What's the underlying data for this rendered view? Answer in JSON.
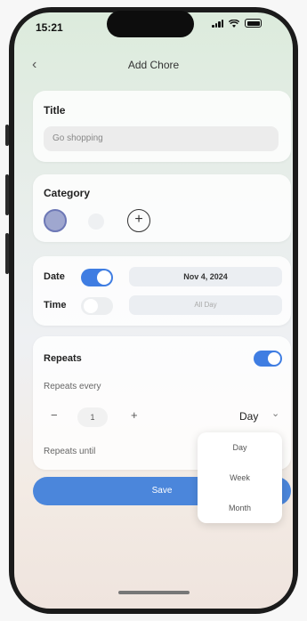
{
  "status_bar": {
    "time": "15:21"
  },
  "nav": {
    "back_label": "‹",
    "title": "Add Chore"
  },
  "title_card": {
    "label": "Title",
    "value": "Go shopping"
  },
  "category_card": {
    "label": "Category",
    "add_label": "+"
  },
  "datetime_card": {
    "date_label": "Date",
    "date_value": "Nov 4, 2024",
    "date_enabled": true,
    "time_label": "Time",
    "time_value": "All Day",
    "time_enabled": false
  },
  "repeats_card": {
    "label": "Repeats",
    "enabled": true,
    "every_label": "Repeats every",
    "minus": "−",
    "count": "1",
    "plus": "+",
    "unit_selected": "Day",
    "unit_chevron": "⌄",
    "until_label": "Repeats until"
  },
  "unit_dropdown": {
    "options": [
      "Day",
      "Week",
      "Month"
    ]
  },
  "save_button": {
    "label": "Save"
  },
  "colors": {
    "accent": "#3f7de2",
    "save": "#4b86db"
  }
}
